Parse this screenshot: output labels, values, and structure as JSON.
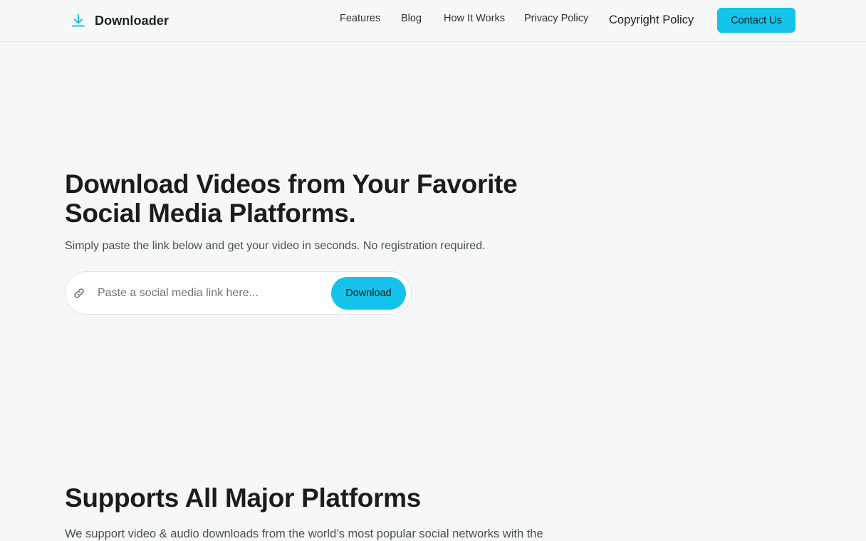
{
  "header": {
    "brand_name": "Downloader",
    "brand_icon": "download-arrow-icon",
    "nav": [
      {
        "label": "Features"
      },
      {
        "label": "Blog"
      },
      {
        "label": "How It Works"
      },
      {
        "label": "Privacy Policy"
      },
      {
        "label": "Copyright Policy"
      }
    ],
    "contact_label": "Contact Us"
  },
  "hero": {
    "title": "Download Videos from Your Favorite Social Media Platforms.",
    "subtitle": "Simply paste the link below and get your video in seconds. No registration required.",
    "input_placeholder": "Paste a social media link here...",
    "input_icon": "link-icon",
    "download_label": "Download"
  },
  "platforms": {
    "title": "Supports All Major Platforms",
    "text": "We support video & audio downloads from the world’s most popular social networks with the"
  },
  "colors": {
    "accent": "#14c3ea",
    "background": "#f6f7f7",
    "text_dark": "#1b1c1e",
    "text_muted": "#4b4f53"
  }
}
